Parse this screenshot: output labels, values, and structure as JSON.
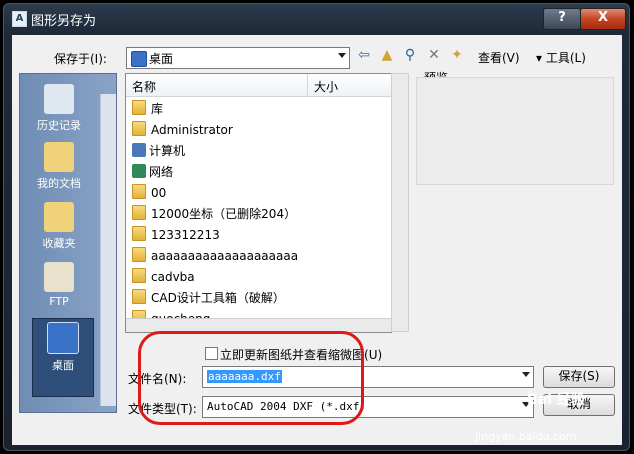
{
  "window": {
    "title": "图形另存为",
    "help": "?",
    "close": "X"
  },
  "save_in": {
    "label": "保存于(I):",
    "value": "桌面"
  },
  "toolbar": {
    "views": "查看(V)",
    "tools": "工具(L)"
  },
  "places": [
    {
      "label": "历史记录",
      "icon": "history-icon"
    },
    {
      "label": "我的文档",
      "icon": "my-documents-icon"
    },
    {
      "label": "收藏夹",
      "icon": "favorites-icon"
    },
    {
      "label": "FTP",
      "icon": "ftp-icon"
    },
    {
      "label": "桌面",
      "icon": "desktop-icon"
    }
  ],
  "columns": {
    "name": "名称",
    "size": "大小"
  },
  "files": [
    "库",
    "Administrator",
    "计算机",
    "网络",
    "00",
    "12000坐标（已删除204）",
    "123312213",
    "aaaaaaaaaaaaaaaaaaaa",
    "cadvba",
    "CAD设计工具箱（破解）",
    "guocheng"
  ],
  "preview": {
    "label": "预览"
  },
  "update_thumbnail": {
    "label": "立即更新图纸并查看缩微图",
    "shortcut": "(U)"
  },
  "filename": {
    "label": "文件名(N):",
    "value": "aaaaaaa.dxf"
  },
  "filetype": {
    "label": "文件类型(T):",
    "value": "AutoCAD 2004 DXF (*.dxf)"
  },
  "buttons": {
    "save": "保存(S)",
    "cancel": "取消"
  },
  "watermark": {
    "brand": "Bai 经验",
    "url": "jingyan.baidu.com"
  }
}
